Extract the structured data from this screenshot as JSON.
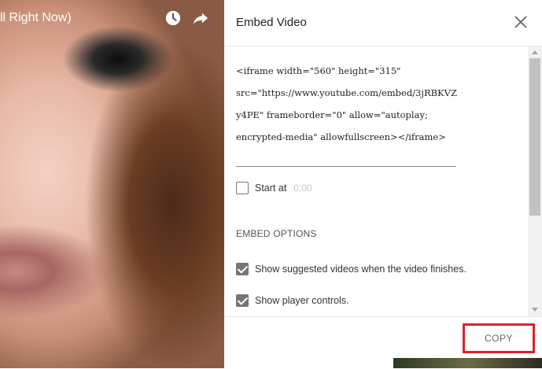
{
  "video": {
    "title": "ll Right Now)"
  },
  "dialog": {
    "title": "Embed Video",
    "embed_code_lines": [
      "<iframe width=\"560\" height=\"315\"",
      "src=\"https://www.youtube.com/embed/3jRBKVZ",
      "y4PE\" frameborder=\"0\" allow=\"autoplay;",
      "encrypted-media\" allowfullscreen></iframe>"
    ],
    "start_at_label": "Start at",
    "start_at_value": "0:00",
    "start_at_checked": false,
    "embed_options_label": "EMBED OPTIONS",
    "options": [
      {
        "label": "Show suggested videos when the video finishes.",
        "checked": true
      },
      {
        "label": "Show player controls.",
        "checked": true
      }
    ],
    "copy_label": "COPY"
  },
  "icons": [
    "clock-icon",
    "share-icon",
    "close-icon"
  ],
  "colors": {
    "copy_highlight": "#e0202a",
    "checkbox_checked": "#757575"
  }
}
